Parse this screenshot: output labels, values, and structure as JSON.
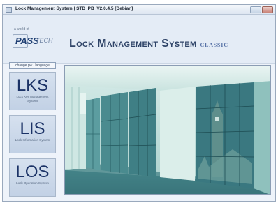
{
  "window": {
    "title": "Lock Management System | STD_PB_V2.0.4.5 [Debian]"
  },
  "header": {
    "logo_tagline": "a world of",
    "logo_pass": "PASS",
    "logo_tech": "TECH",
    "title": "Lock Management System",
    "edition": "classic"
  },
  "sidebar": {
    "language_button": "change pw / language",
    "systems": [
      {
        "code": "LKS",
        "name": "Lock Key Management System"
      },
      {
        "code": "LIS",
        "name": "Lock Information System"
      },
      {
        "code": "LOS",
        "name": "Lock Operation System"
      }
    ]
  },
  "colors": {
    "header_bg": "#e4ecf6",
    "brand_text": "#2f4468",
    "accent": "#5671a6",
    "photo_tint": "#3e8f8c"
  }
}
